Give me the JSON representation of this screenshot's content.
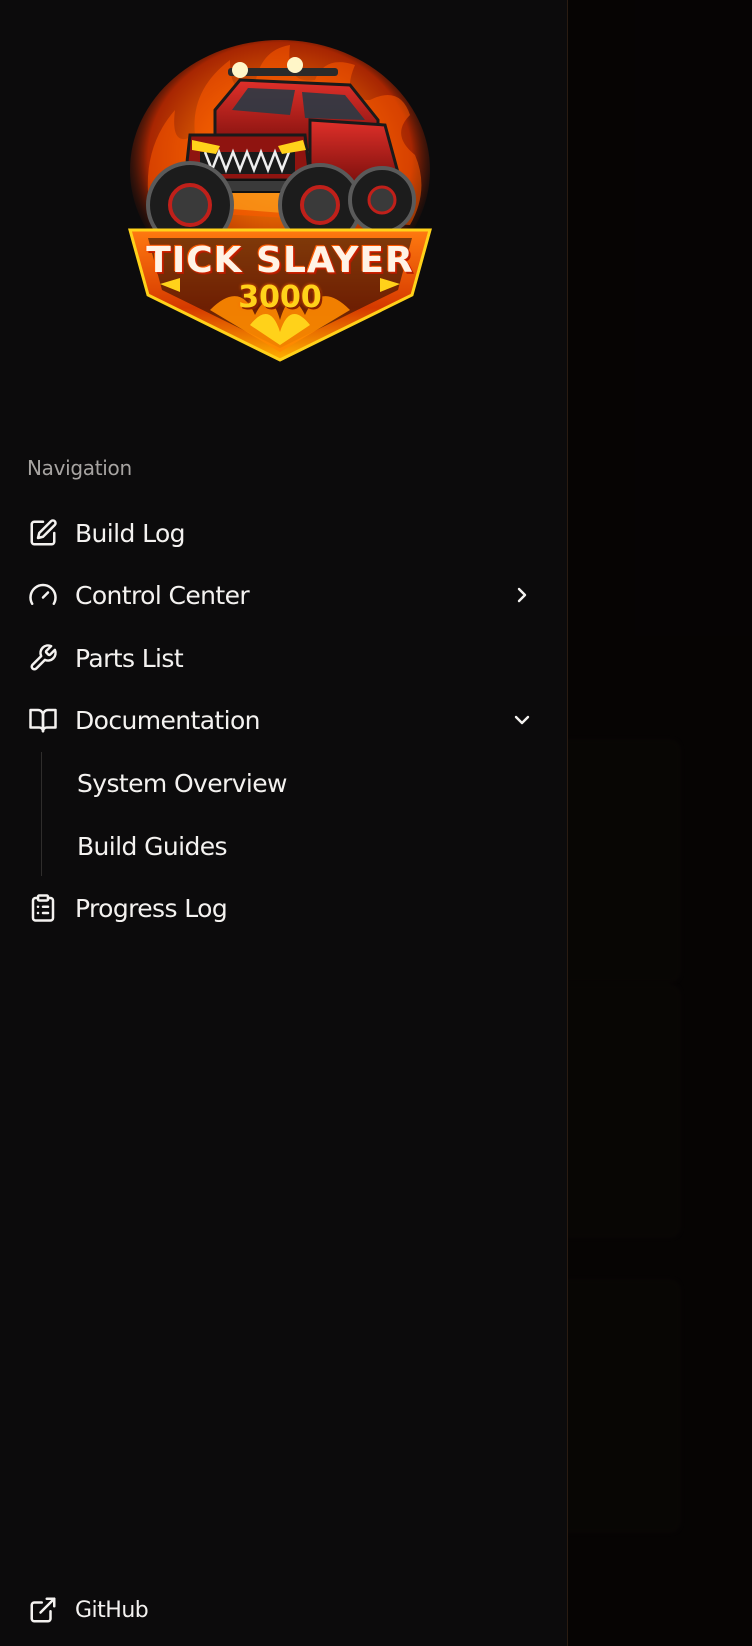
{
  "logo": {
    "title": "TICK SLAYER",
    "subtitle": "3000",
    "colors": {
      "flame": "#ff6a00",
      "flame_deep": "#c22a00",
      "gold": "#ffd21a",
      "truck_red": "#c0201a"
    }
  },
  "navigation": {
    "heading": "Navigation",
    "items": [
      {
        "label": "Build Log",
        "icon": "edit-icon",
        "chevron": "none"
      },
      {
        "label": "Control Center",
        "icon": "gauge-icon",
        "chevron": "right"
      },
      {
        "label": "Parts List",
        "icon": "wrench-icon",
        "chevron": "none"
      },
      {
        "label": "Documentation",
        "icon": "book-open-icon",
        "chevron": "down",
        "children": [
          {
            "label": "System Overview"
          },
          {
            "label": "Build Guides"
          }
        ]
      },
      {
        "label": "Progress Log",
        "icon": "clipboard-list-icon",
        "chevron": "none"
      }
    ]
  },
  "footer": {
    "github_label": "GitHub",
    "icon": "external-link-icon"
  },
  "theme": {
    "drawer_bg": "#0c0b0c",
    "text": "#f4f2f0",
    "muted": "#a7a4a2",
    "accent_border": "#2a1c12"
  }
}
